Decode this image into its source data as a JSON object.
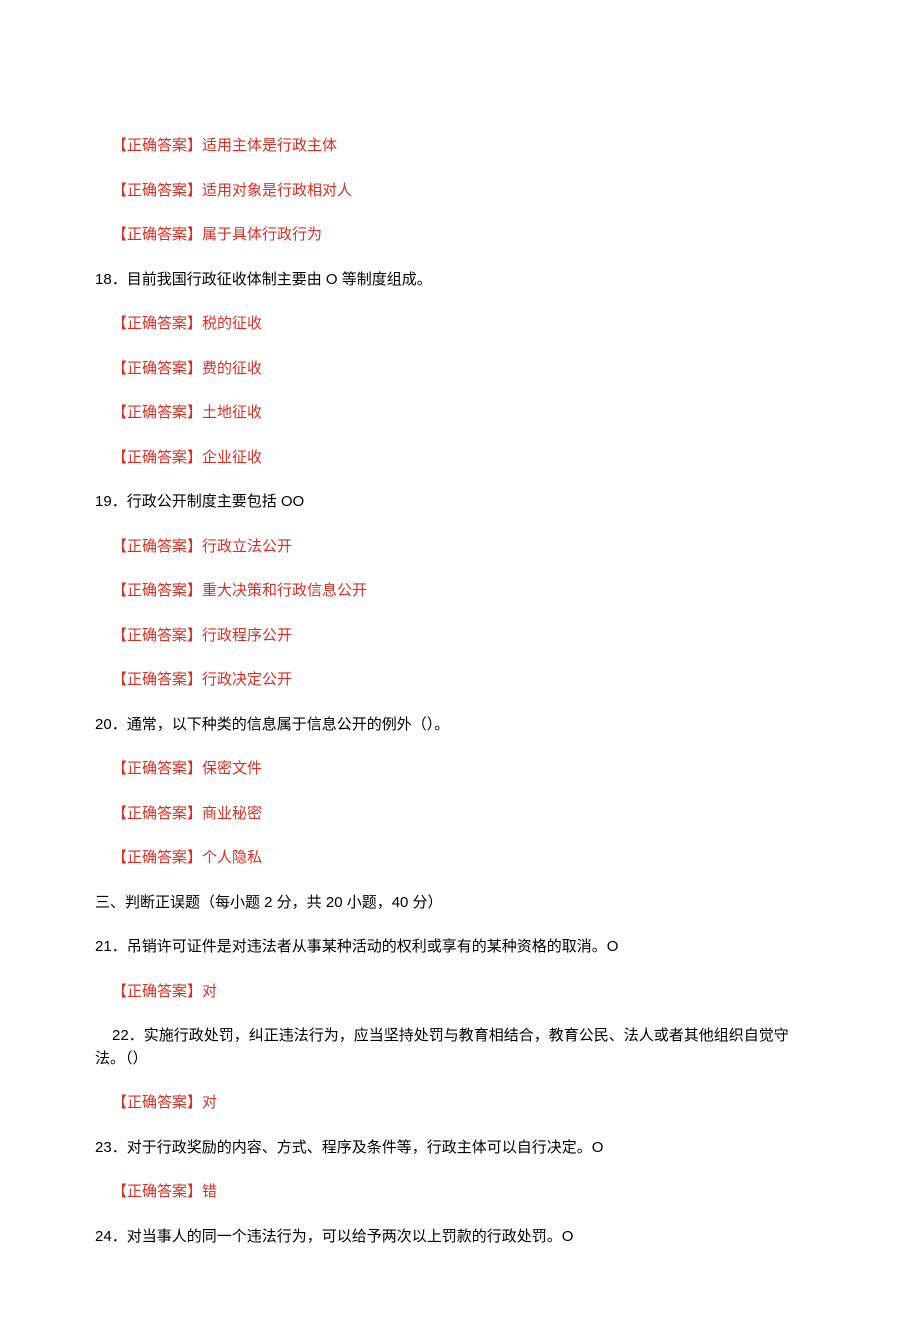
{
  "q17_answers": [
    {
      "label": "【正确答案】",
      "text": "适用主体是行政主体"
    },
    {
      "label": "【正确答案】",
      "text": "适用对象是行政相对人"
    },
    {
      "label": "【正确答案】",
      "text": "属于具体行政行为"
    }
  ],
  "q18": {
    "num": "18",
    "text": "．目前我国行政征收体制主要由 O 等制度组成。",
    "answers": [
      {
        "label": "【正确答案】",
        "text": "税的征收"
      },
      {
        "label": "【正确答案】",
        "text": "费的征收"
      },
      {
        "label": "【正确答案】",
        "text": "土地征收"
      },
      {
        "label": "【正确答案】",
        "text": "企业征收"
      }
    ]
  },
  "q19": {
    "num": "19",
    "text": "．行政公开制度主要包括 OO",
    "answers": [
      {
        "label": "【正确答案】",
        "text": "行政立法公开"
      },
      {
        "label": "【正确答案】",
        "text": "重大决策和行政信息公开"
      },
      {
        "label": "【正确答案】",
        "text": "行政程序公开"
      },
      {
        "label": "【正确答案】",
        "text": "行政决定公开"
      }
    ]
  },
  "q20": {
    "num": "20",
    "text": "．通常，以下种类的信息属于信息公开的例外（）。",
    "answers": [
      {
        "label": "【正确答案】",
        "text": "保密文件"
      },
      {
        "label": "【正确答案】",
        "text": "商业秘密"
      },
      {
        "label": "【正确答案】",
        "text": "个人隐私"
      }
    ]
  },
  "section3": "三、判断正误题（每小题 2 分，共 20 小题，40 分）",
  "q21": {
    "num": "21",
    "text": "．吊销许可证件是对违法者从事某种活动的权利或享有的某种资格的取消。O",
    "answer_label": "【正确答案】",
    "answer_text": "对"
  },
  "q22": {
    "num": "22",
    "line1": "．实施行政处罚，纠正违法行为，应当坚持处罚与教育相结合，教育公民、法人或者其他组织自觉守",
    "line2": "法。（）",
    "answer_label": "【正确答案】",
    "answer_text": "对"
  },
  "q23": {
    "num": "23",
    "text": "．对于行政奖励的内容、方式、程序及条件等，行政主体可以自行决定。O",
    "answer_label": "【正确答案】",
    "answer_text": "错"
  },
  "q24": {
    "num": "24",
    "text": "．对当事人的同一个违法行为，可以给予两次以上罚款的行政处罚。O"
  }
}
